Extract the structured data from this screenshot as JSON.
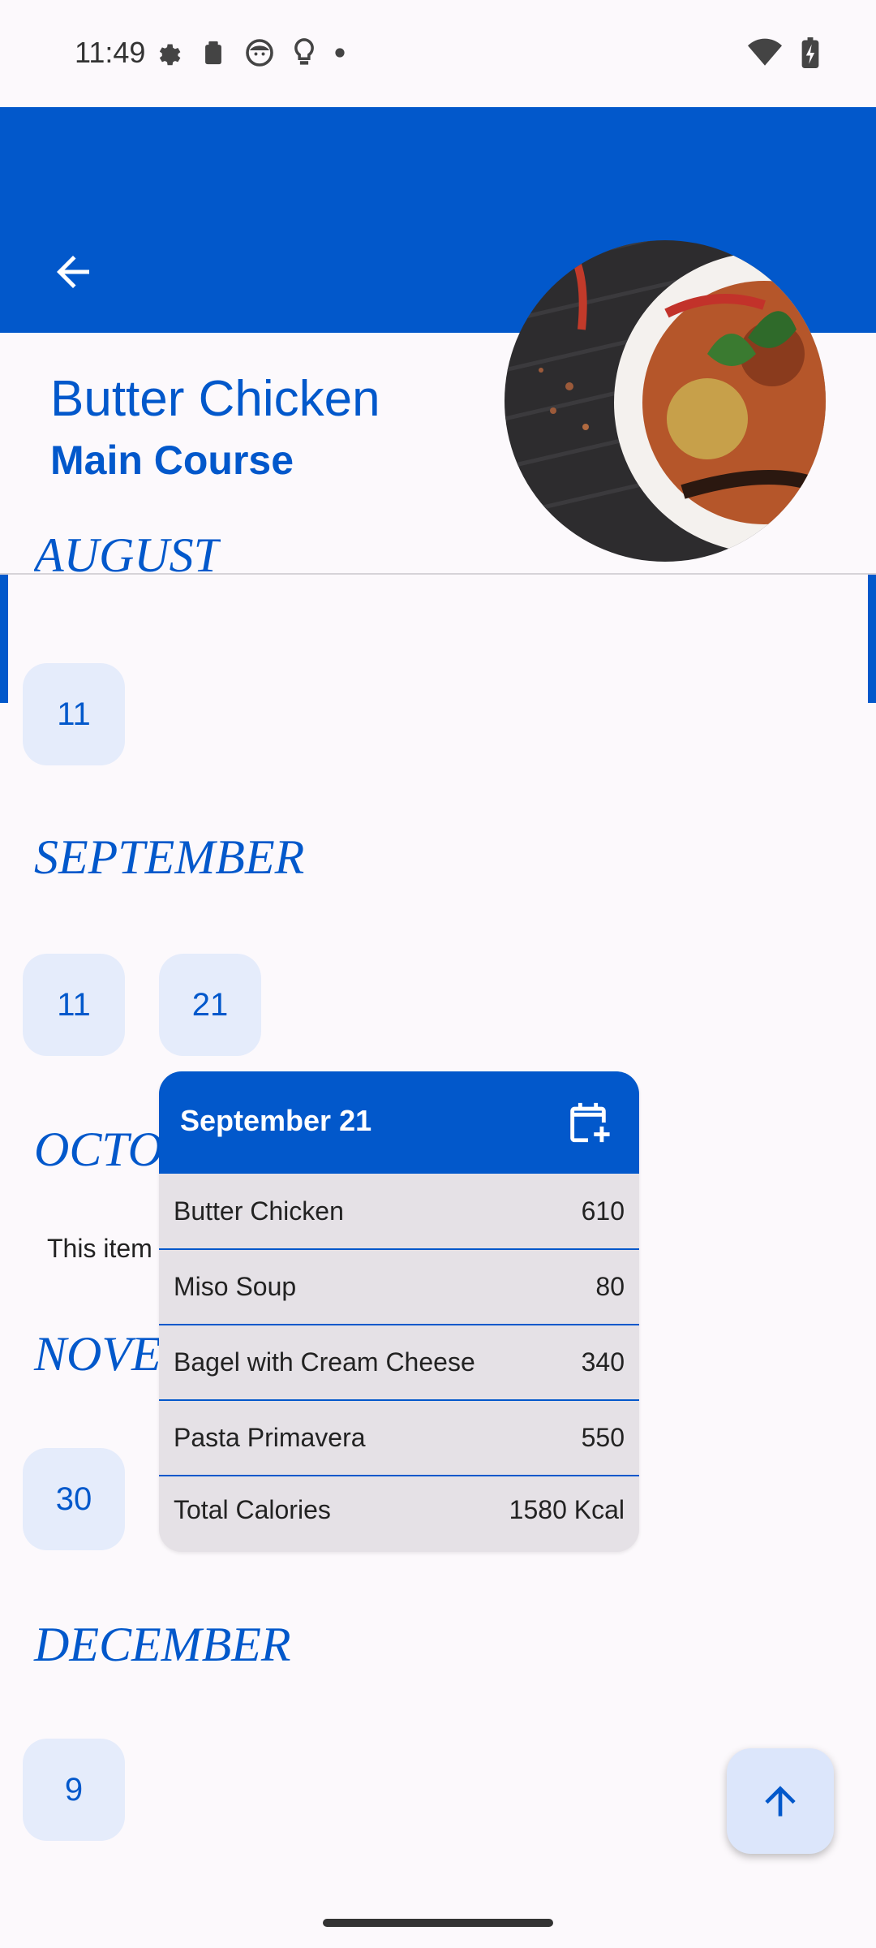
{
  "status_bar": {
    "time": "11:49",
    "left_icons": [
      "settings-icon",
      "clipboard-icon",
      "face-icon",
      "lightbulb-icon",
      "dot-icon"
    ],
    "right_icons": [
      "wifi-icon",
      "battery-charging-icon"
    ]
  },
  "header": {
    "back_icon": "arrow-left-icon",
    "title": "Butter Chicken",
    "subtitle": "Main Course",
    "accent_color": "#0258CB"
  },
  "months": [
    {
      "label": "AUGUST",
      "days": [
        "11"
      ]
    },
    {
      "label": "SEPTEMBER",
      "days": [
        "11",
        "21"
      ]
    },
    {
      "label": "OCTOBER",
      "note": "This item"
    },
    {
      "label": "NOVEMBER",
      "days": [
        "30"
      ]
    },
    {
      "label": "DECEMBER",
      "days": [
        "9"
      ]
    }
  ],
  "popup": {
    "date": "September 21",
    "icon": "calendar-add-icon",
    "items": [
      {
        "name": "Butter Chicken",
        "calories": "610"
      },
      {
        "name": "Miso Soup",
        "calories": "80"
      },
      {
        "name": "Bagel with Cream Cheese",
        "calories": "340"
      },
      {
        "name": "Pasta Primavera",
        "calories": "550"
      }
    ],
    "total_label": "Total Calories",
    "total_value": "1580 Kcal"
  },
  "fab": {
    "icon": "arrow-up-icon"
  }
}
